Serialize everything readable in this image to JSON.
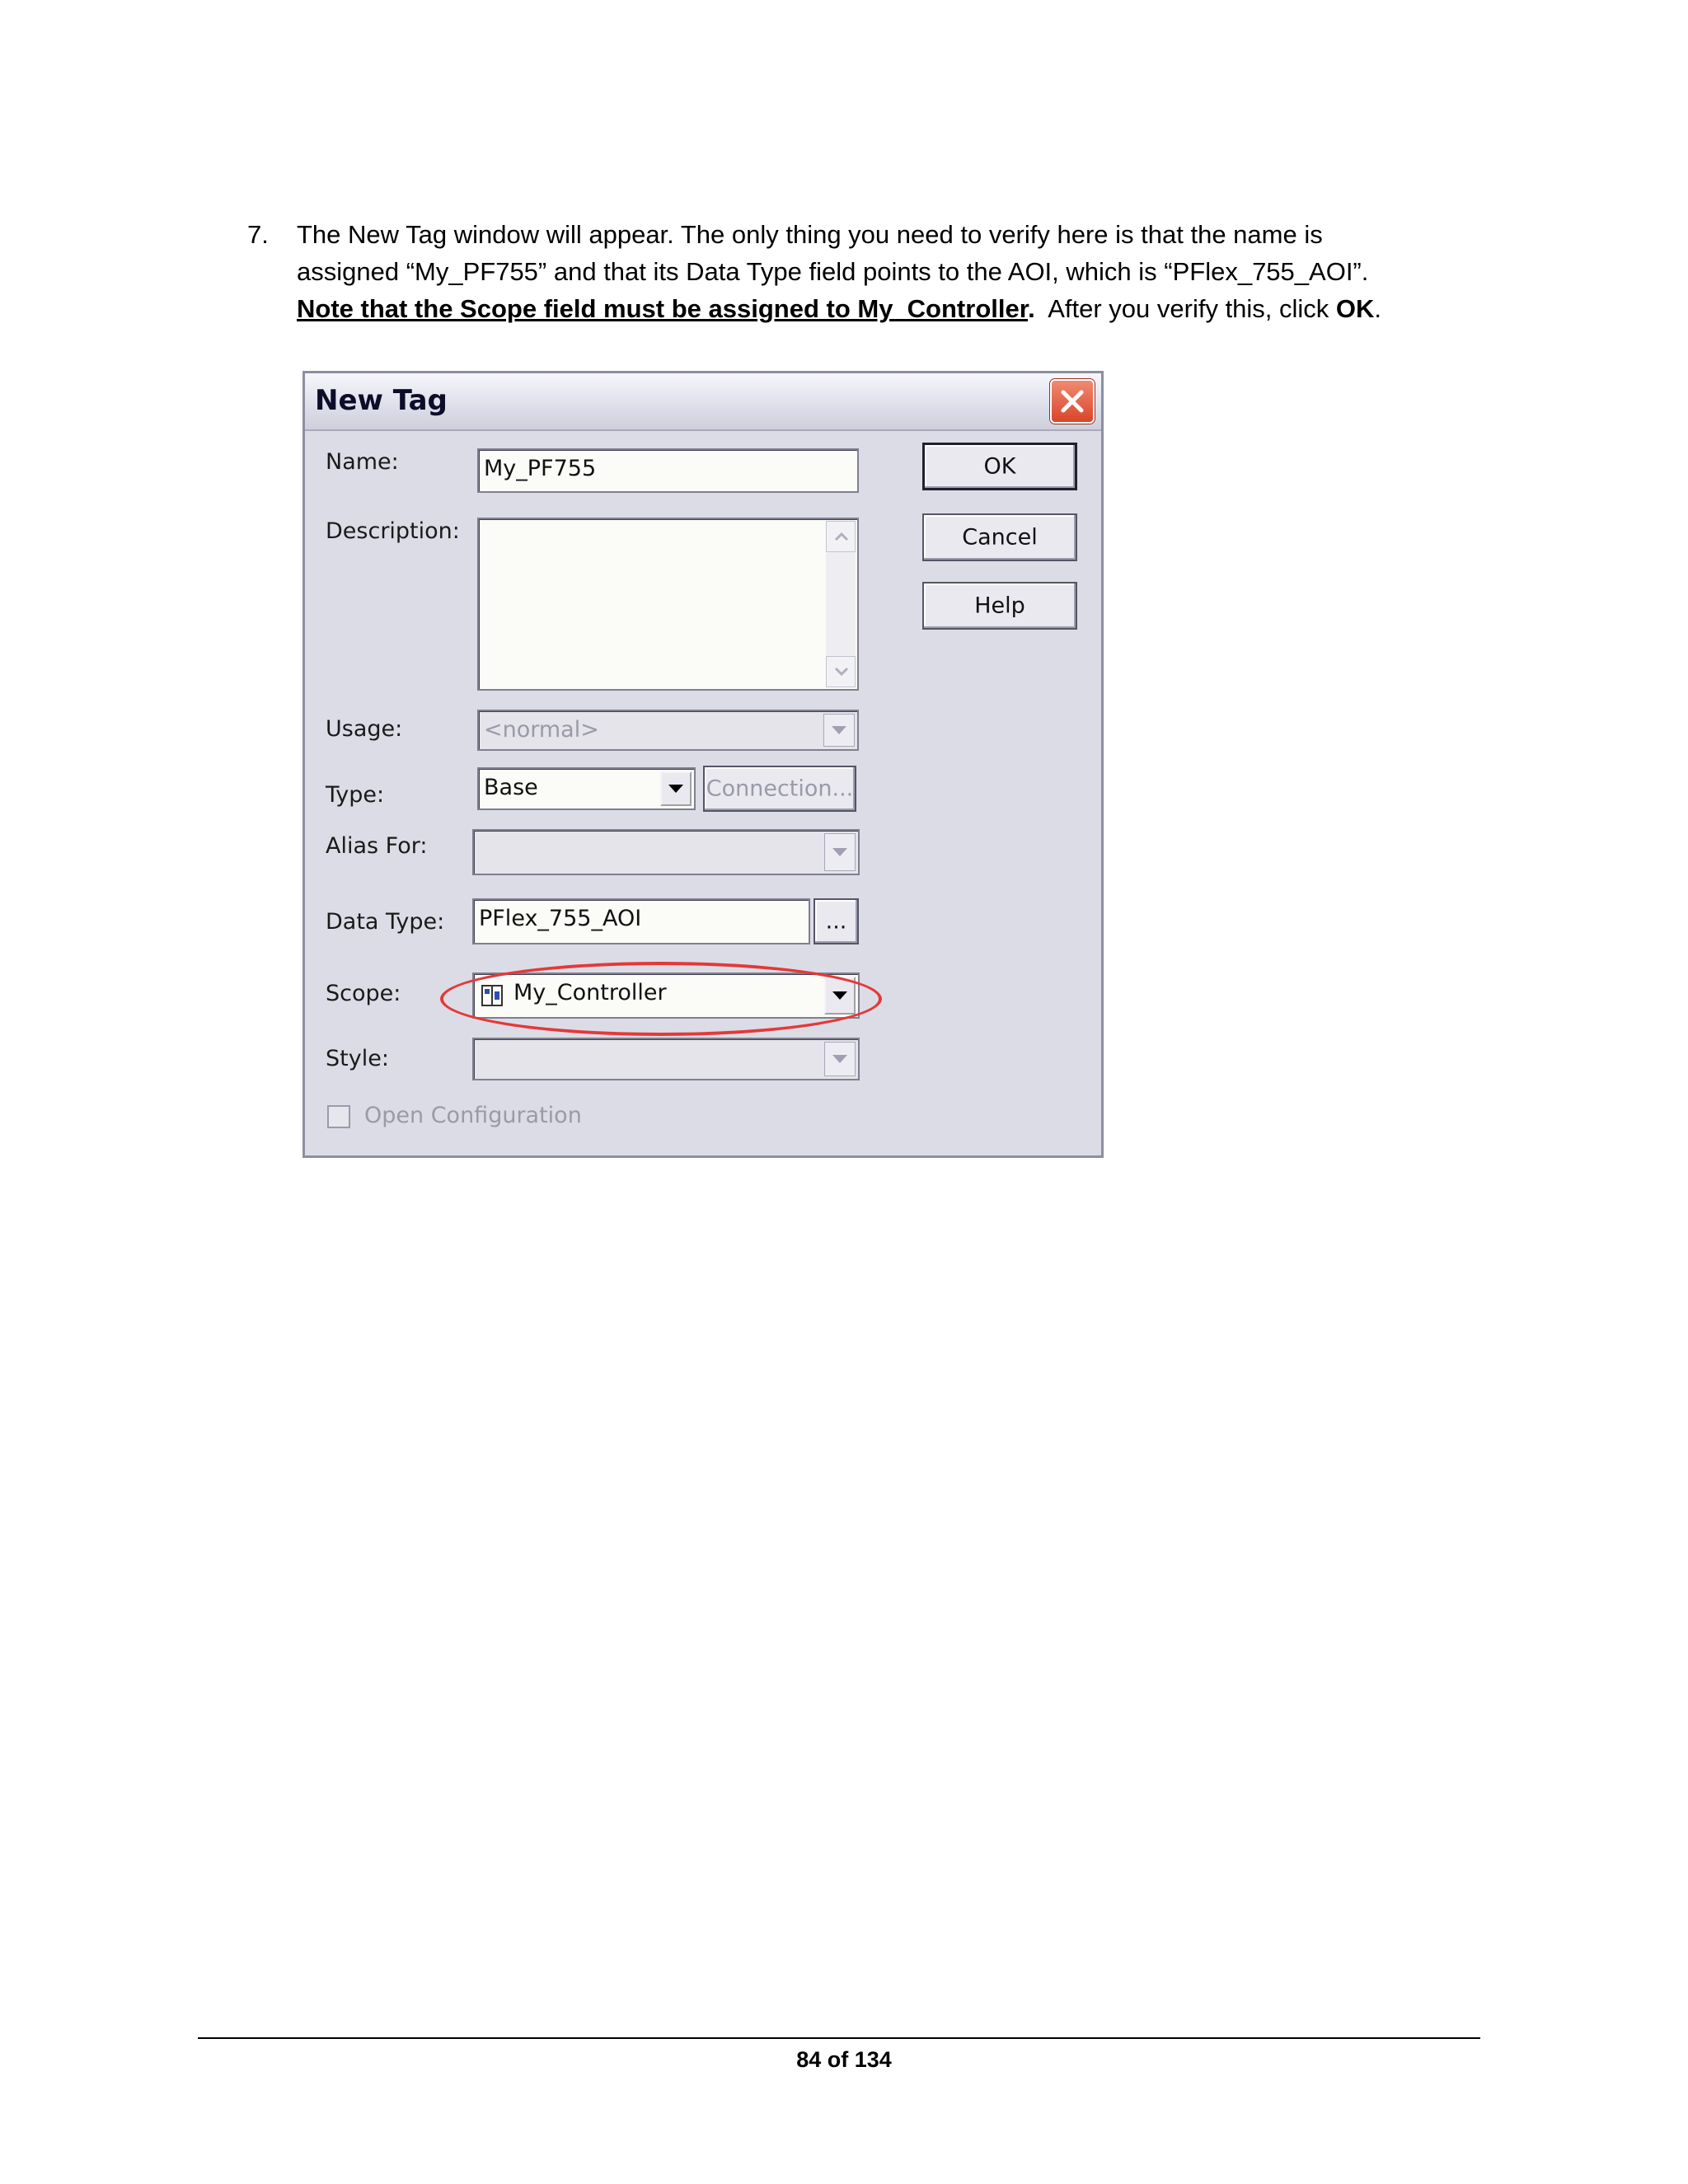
{
  "instruction": {
    "number": "7.",
    "line1": "The New Tag window will appear.  The only thing you need to verify here is that the name is",
    "line2": "assigned “My_PF755” and that its Data Type field points to the AOI, which is “PFlex_755_AOI”.",
    "note": "Note that the Scope field must be assigned to My_Controller",
    "note_end": ".",
    "after": "  After you verify this, click ",
    "ok_word": "OK",
    "end": "."
  },
  "dialog": {
    "title": "New Tag",
    "name_label": "Name:",
    "name_value": "My_PF755",
    "description_label": "Description:",
    "usage_label": "Usage:",
    "usage_value": "<normal>",
    "type_label": "Type:",
    "type_value": "Base",
    "connection_button": "Connection...",
    "alias_label": "Alias For:",
    "data_type_label": "Data Type:",
    "data_type_value": "PFlex_755_AOI",
    "browse_button": "...",
    "scope_label": "Scope:",
    "scope_value": "My_Controller",
    "style_label": "Style:",
    "open_config_label": "Open Configuration",
    "ok_button": "OK",
    "cancel_button": "Cancel",
    "help_button": "Help"
  },
  "footer": {
    "page": "84 of 134"
  },
  "colors": {
    "highlight": "#e53838",
    "dialog_bg": "#dcdce6",
    "close_red": "#d9452a"
  }
}
